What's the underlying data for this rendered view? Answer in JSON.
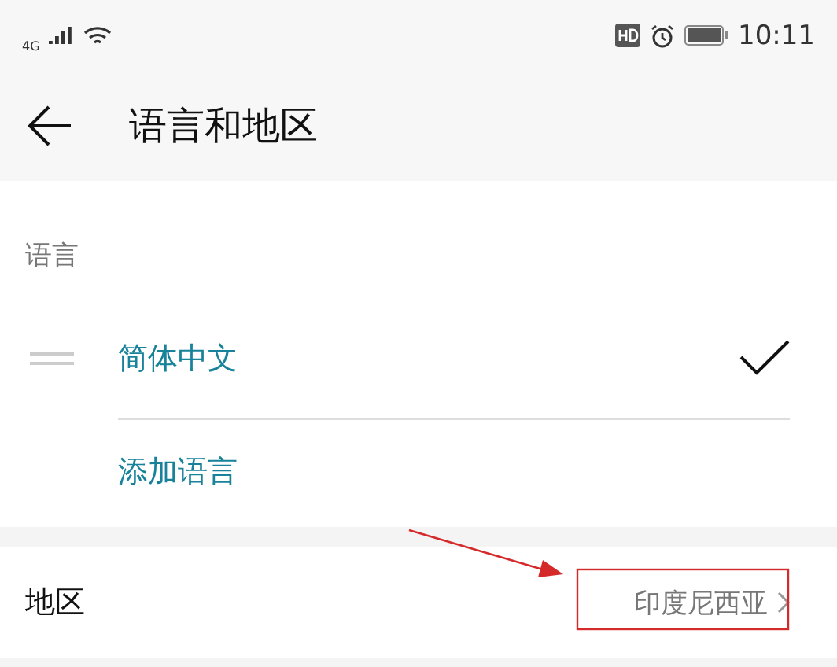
{
  "status_bar": {
    "network": "4G",
    "time": "10:11"
  },
  "header": {
    "title": "语言和地区"
  },
  "language_section": {
    "label": "语言",
    "languages": [
      {
        "name": "简体中文",
        "selected": true
      }
    ],
    "add_language": "添加语言"
  },
  "region": {
    "label": "地区",
    "value": "印度尼西亚"
  },
  "annotation": {
    "color": "#d42a2a"
  }
}
